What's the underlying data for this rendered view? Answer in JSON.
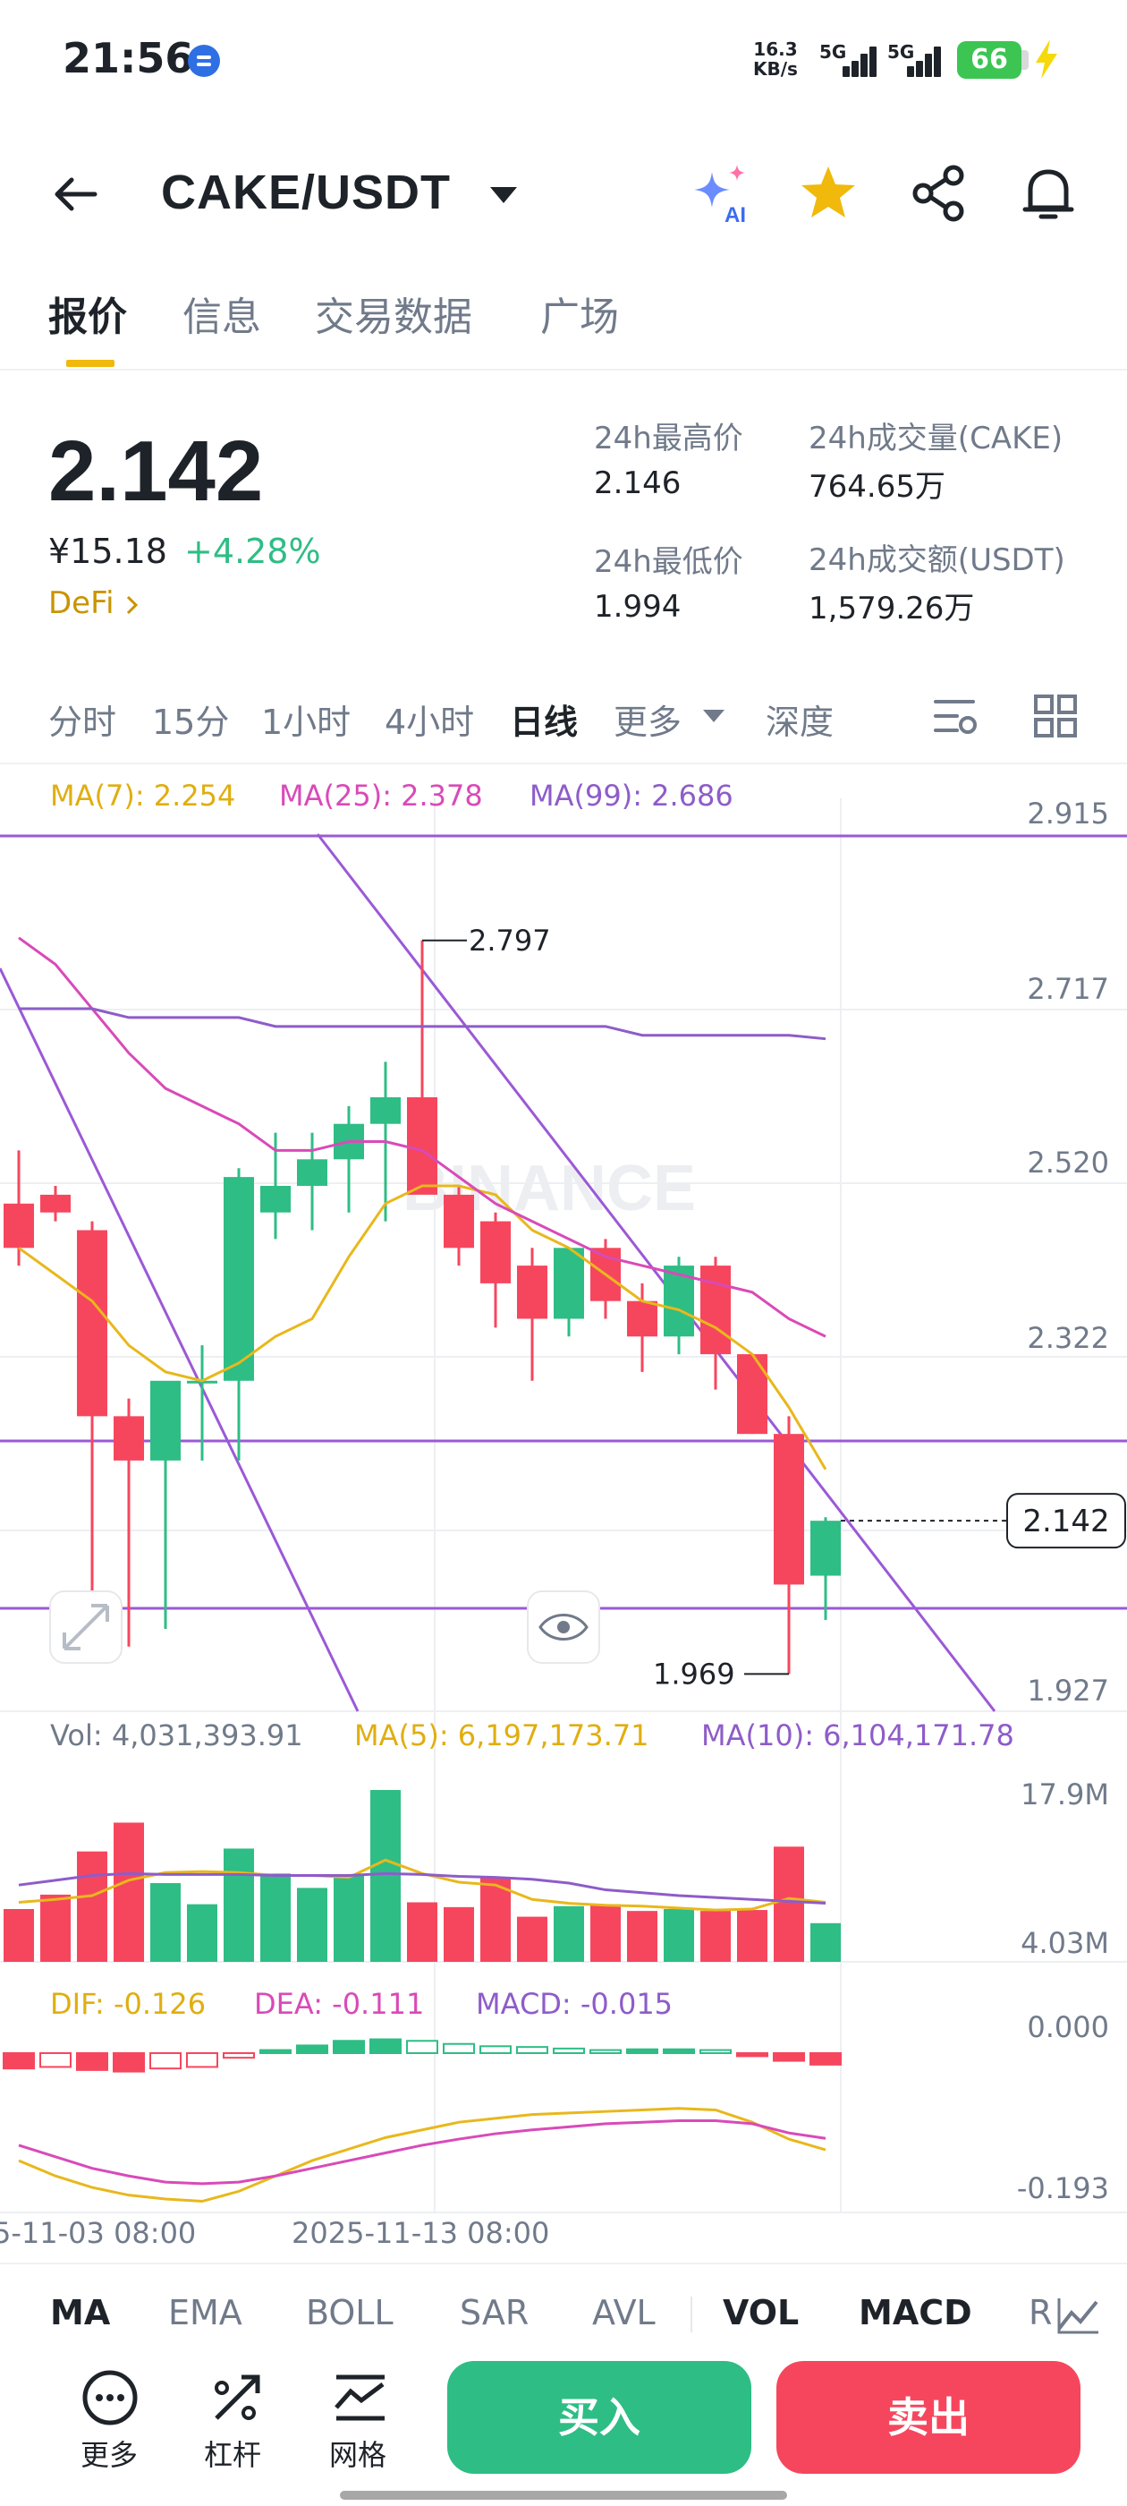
{
  "status_bar": {
    "time": "21:56",
    "net_speed_value": "16.3",
    "net_speed_unit": "KB/s",
    "sim1": "5G",
    "sim2": "5G",
    "battery": "66"
  },
  "header": {
    "pair": "CAKE/USDT",
    "icons": [
      "back-arrow-icon",
      "caret-down-icon",
      "ai-sparkle-icon",
      "star-icon",
      "share-icon",
      "bell-icon"
    ]
  },
  "tabs": [
    {
      "label": "报价",
      "active": true
    },
    {
      "label": "信息",
      "active": false
    },
    {
      "label": "交易数据",
      "active": false
    },
    {
      "label": "广场",
      "active": false
    }
  ],
  "price": {
    "last": "2.142",
    "cny": "¥15.18",
    "change": "+4.28%",
    "sector": "DeFi",
    "stats": [
      {
        "label": "24h最高价",
        "value": "2.146"
      },
      {
        "label": "24h成交量(CAKE)",
        "value": "764.65万"
      },
      {
        "label": "24h最低价",
        "value": "1.994"
      },
      {
        "label": "24h成交额(USDT)",
        "value": "1,579.26万"
      }
    ]
  },
  "intervals": [
    {
      "label": "分时",
      "active": false
    },
    {
      "label": "15分",
      "active": false
    },
    {
      "label": "1小时",
      "active": false
    },
    {
      "label": "4小时",
      "active": false
    },
    {
      "label": "日线",
      "active": true
    },
    {
      "label": "更多",
      "active": false
    },
    {
      "label": "深度",
      "active": false
    }
  ],
  "ma_legend": {
    "ma7": "MA(7): 2.254",
    "ma25": "MA(25): 2.378",
    "ma99": "MA(99): 2.686"
  },
  "vol_legend": {
    "vol": "Vol: 4,031,393.91",
    "ma5": "MA(5): 6,197,173.71",
    "ma10": "MA(10): 6,104,171.78"
  },
  "macd_legend": {
    "dif": "DIF: -0.126",
    "dea": "DEA: -0.111",
    "macd": "MACD: -0.015"
  },
  "watermark": "BINANCE",
  "chart_data": [
    {
      "type": "candlestick",
      "yaxis_labels": [
        "2.915",
        "2.717",
        "2.520",
        "2.322",
        "1.927"
      ],
      "ylim": [
        1.927,
        2.915
      ],
      "high_marker": "2.797",
      "low_marker": "1.969",
      "last_price_tag": "2.142",
      "candles": [
        {
          "o": 2.5,
          "h": 2.56,
          "l": 2.43,
          "c": 2.45
        },
        {
          "o": 2.51,
          "h": 2.52,
          "l": 2.48,
          "c": 2.49
        },
        {
          "o": 2.47,
          "h": 2.48,
          "l": 2.03,
          "c": 2.26
        },
        {
          "o": 2.26,
          "h": 2.28,
          "l": 2.0,
          "c": 2.21
        },
        {
          "o": 2.21,
          "h": 2.28,
          "l": 2.02,
          "c": 2.3
        },
        {
          "o": 2.3,
          "h": 2.34,
          "l": 2.21,
          "c": 2.3
        },
        {
          "o": 2.3,
          "h": 2.54,
          "l": 2.21,
          "c": 2.53
        },
        {
          "o": 2.49,
          "h": 2.58,
          "l": 2.46,
          "c": 2.52
        },
        {
          "o": 2.52,
          "h": 2.58,
          "l": 2.47,
          "c": 2.55
        },
        {
          "o": 2.55,
          "h": 2.61,
          "l": 2.49,
          "c": 2.59
        },
        {
          "o": 2.59,
          "h": 2.66,
          "l": 2.48,
          "c": 2.62
        },
        {
          "o": 2.62,
          "h": 2.797,
          "l": 2.53,
          "c": 2.51
        },
        {
          "o": 2.51,
          "h": 2.52,
          "l": 2.43,
          "c": 2.45
        },
        {
          "o": 2.48,
          "h": 2.49,
          "l": 2.36,
          "c": 2.41
        },
        {
          "o": 2.43,
          "h": 2.45,
          "l": 2.3,
          "c": 2.37
        },
        {
          "o": 2.37,
          "h": 2.45,
          "l": 2.35,
          "c": 2.45
        },
        {
          "o": 2.45,
          "h": 2.46,
          "l": 2.37,
          "c": 2.39
        },
        {
          "o": 2.39,
          "h": 2.41,
          "l": 2.31,
          "c": 2.35
        },
        {
          "o": 2.35,
          "h": 2.44,
          "l": 2.33,
          "c": 2.43
        },
        {
          "o": 2.43,
          "h": 2.44,
          "l": 2.29,
          "c": 2.33
        },
        {
          "o": 2.33,
          "h": 2.33,
          "l": 2.24,
          "c": 2.24
        },
        {
          "o": 2.24,
          "h": 2.26,
          "l": 1.969,
          "c": 2.07
        },
        {
          "o": 2.08,
          "h": 2.146,
          "l": 2.03,
          "c": 2.142
        }
      ],
      "ma7": [
        2.45,
        2.42,
        2.39,
        2.34,
        2.31,
        2.3,
        2.32,
        2.35,
        2.37,
        2.44,
        2.5,
        2.52,
        2.52,
        2.51,
        2.47,
        2.45,
        2.42,
        2.39,
        2.38,
        2.36,
        2.33,
        2.27,
        2.2
      ],
      "ma25": [
        2.8,
        2.77,
        2.72,
        2.67,
        2.63,
        2.61,
        2.59,
        2.56,
        2.56,
        2.57,
        2.57,
        2.56,
        2.53,
        2.5,
        2.48,
        2.46,
        2.44,
        2.43,
        2.42,
        2.41,
        2.4,
        2.37,
        2.35
      ],
      "ma99": [
        2.72,
        2.72,
        2.72,
        2.71,
        2.71,
        2.71,
        2.71,
        2.7,
        2.7,
        2.7,
        2.7,
        2.7,
        2.7,
        2.7,
        2.7,
        2.7,
        2.7,
        2.69,
        2.69,
        2.69,
        2.69,
        2.69,
        2.686
      ]
    },
    {
      "type": "bar",
      "yaxis_labels": [
        "17.9M",
        "4.03M"
      ],
      "ylim": [
        0,
        17.9
      ],
      "values_m": [
        5.5,
        7.0,
        11.5,
        14.5,
        8.2,
        6.0,
        11.8,
        9.2,
        7.7,
        9.0,
        17.9,
        6.2,
        5.7,
        8.8,
        4.7,
        5.8,
        6.0,
        5.3,
        5.5,
        5.3,
        5.4,
        12.0,
        4.03
      ],
      "ma5_m": [
        6.2,
        6.5,
        6.9,
        8.5,
        9.3,
        9.4,
        9.3,
        9.0,
        9.0,
        8.8,
        10.6,
        9.2,
        8.3,
        8.0,
        6.5,
        6.1,
        5.9,
        5.8,
        5.6,
        5.4,
        5.5,
        6.6,
        6.197
      ],
      "ma10_m": [
        8.0,
        8.5,
        9.0,
        9.2,
        9.1,
        9.1,
        9.1,
        9.0,
        9.0,
        9.0,
        9.2,
        9.1,
        8.9,
        8.8,
        8.6,
        8.2,
        7.5,
        7.2,
        6.9,
        6.7,
        6.5,
        6.3,
        6.104
      ]
    },
    {
      "type": "bar",
      "yaxis_labels": [
        "0.000",
        "-0.193"
      ],
      "ylim": [
        -0.193,
        0.02
      ],
      "macd": [
        -0.02,
        -0.018,
        -0.022,
        -0.024,
        -0.02,
        -0.018,
        -0.006,
        0.004,
        0.01,
        0.016,
        0.018,
        0.016,
        0.012,
        0.009,
        0.008,
        0.006,
        0.004,
        0.005,
        0.005,
        0.004,
        -0.004,
        -0.01,
        -0.015
      ],
      "dif": [
        -0.14,
        -0.16,
        -0.175,
        -0.185,
        -0.19,
        -0.193,
        -0.18,
        -0.16,
        -0.14,
        -0.125,
        -0.11,
        -0.1,
        -0.09,
        -0.085,
        -0.08,
        -0.078,
        -0.076,
        -0.074,
        -0.072,
        -0.074,
        -0.09,
        -0.112,
        -0.126
      ],
      "dea": [
        -0.12,
        -0.135,
        -0.15,
        -0.16,
        -0.168,
        -0.17,
        -0.168,
        -0.16,
        -0.15,
        -0.14,
        -0.13,
        -0.12,
        -0.112,
        -0.105,
        -0.1,
        -0.096,
        -0.092,
        -0.09,
        -0.088,
        -0.088,
        -0.092,
        -0.104,
        -0.111
      ]
    }
  ],
  "x_axis_dates": [
    "5-11-03 08:00",
    "2025-11-13 08:00"
  ],
  "indicator_tabs": [
    {
      "label": "MA",
      "on": true
    },
    {
      "label": "EMA",
      "on": false
    },
    {
      "label": "BOLL",
      "on": false
    },
    {
      "label": "SAR",
      "on": false
    },
    {
      "label": "AVL",
      "on": false
    },
    {
      "label": "VOL",
      "on": true
    },
    {
      "label": "MACD",
      "on": true
    },
    {
      "label": "R",
      "on": false
    }
  ],
  "tools": [
    {
      "label": "更多",
      "icon": "more-icon"
    },
    {
      "label": "杠杆",
      "icon": "leverage-icon"
    },
    {
      "label": "网格",
      "icon": "grid-trading-icon"
    }
  ],
  "actions": {
    "buy": "买入",
    "sell": "卖出"
  },
  "colors": {
    "up": "#2ebd85",
    "down": "#f6465d",
    "accent": "#f0b90b",
    "ma7": "#e8b81c",
    "ma25": "#d94ab8",
    "ma99": "#8e5cc9",
    "trendline": "#9b59d6"
  }
}
